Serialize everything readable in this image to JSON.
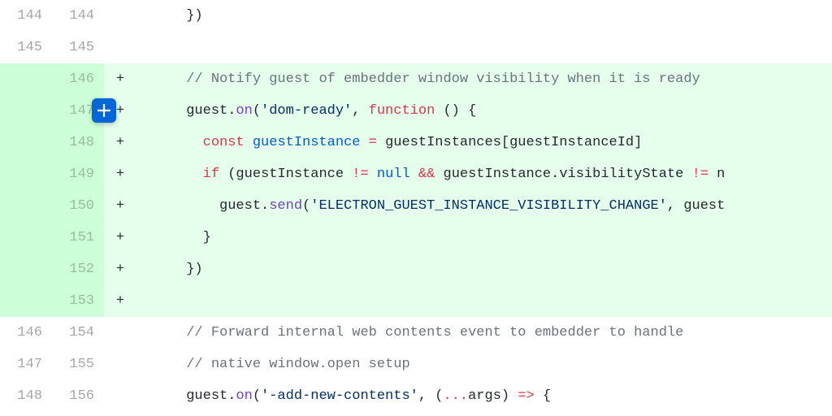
{
  "rows": [
    {
      "old": "144",
      "new": "144",
      "marker": "",
      "type": "context",
      "tokens": [
        {
          "t": "      })",
          "c": ""
        }
      ]
    },
    {
      "old": "145",
      "new": "145",
      "marker": "",
      "type": "context",
      "tokens": [
        {
          "t": "",
          "c": ""
        }
      ]
    },
    {
      "old": "",
      "new": "146",
      "marker": "+",
      "type": "added",
      "tokens": [
        {
          "t": "      ",
          "c": ""
        },
        {
          "t": "// Notify guest of embedder window visibility when it is ready",
          "c": "c-comment"
        }
      ]
    },
    {
      "old": "",
      "new": "147",
      "marker": "+",
      "type": "added",
      "addbtn": true,
      "tokens": [
        {
          "t": "      guest.",
          "c": ""
        },
        {
          "t": "on",
          "c": "c-func"
        },
        {
          "t": "(",
          "c": ""
        },
        {
          "t": "'dom-ready'",
          "c": "c-str"
        },
        {
          "t": ", ",
          "c": ""
        },
        {
          "t": "function",
          "c": "c-kw"
        },
        {
          "t": " () {",
          "c": ""
        }
      ]
    },
    {
      "old": "",
      "new": "148",
      "marker": "+",
      "type": "added",
      "tokens": [
        {
          "t": "        ",
          "c": ""
        },
        {
          "t": "const",
          "c": "c-kw"
        },
        {
          "t": " ",
          "c": ""
        },
        {
          "t": "guestInstance",
          "c": "c-const"
        },
        {
          "t": " ",
          "c": ""
        },
        {
          "t": "=",
          "c": "c-kw"
        },
        {
          "t": " guestInstances[guestInstanceId]",
          "c": ""
        }
      ]
    },
    {
      "old": "",
      "new": "149",
      "marker": "+",
      "type": "added",
      "tokens": [
        {
          "t": "        ",
          "c": ""
        },
        {
          "t": "if",
          "c": "c-kw"
        },
        {
          "t": " (guestInstance ",
          "c": ""
        },
        {
          "t": "!=",
          "c": "c-kw"
        },
        {
          "t": " ",
          "c": ""
        },
        {
          "t": "null",
          "c": "c-const"
        },
        {
          "t": " ",
          "c": ""
        },
        {
          "t": "&&",
          "c": "c-kw"
        },
        {
          "t": " guestInstance.visibilityState ",
          "c": ""
        },
        {
          "t": "!=",
          "c": "c-kw"
        },
        {
          "t": " n",
          "c": ""
        }
      ]
    },
    {
      "old": "",
      "new": "150",
      "marker": "+",
      "type": "added",
      "tokens": [
        {
          "t": "          guest.",
          "c": ""
        },
        {
          "t": "send",
          "c": "c-func"
        },
        {
          "t": "(",
          "c": ""
        },
        {
          "t": "'ELECTRON_GUEST_INSTANCE_VISIBILITY_CHANGE'",
          "c": "c-str"
        },
        {
          "t": ", guest",
          "c": ""
        }
      ]
    },
    {
      "old": "",
      "new": "151",
      "marker": "+",
      "type": "added",
      "tokens": [
        {
          "t": "        }",
          "c": ""
        }
      ]
    },
    {
      "old": "",
      "new": "152",
      "marker": "+",
      "type": "added",
      "tokens": [
        {
          "t": "      })",
          "c": ""
        }
      ]
    },
    {
      "old": "",
      "new": "153",
      "marker": "+",
      "type": "added",
      "tokens": [
        {
          "t": "",
          "c": ""
        }
      ]
    },
    {
      "old": "146",
      "new": "154",
      "marker": "",
      "type": "context",
      "tokens": [
        {
          "t": "      ",
          "c": ""
        },
        {
          "t": "// Forward internal web contents event to embedder to handle",
          "c": "c-comment"
        }
      ]
    },
    {
      "old": "147",
      "new": "155",
      "marker": "",
      "type": "context",
      "tokens": [
        {
          "t": "      ",
          "c": ""
        },
        {
          "t": "// native window.open setup",
          "c": "c-comment"
        }
      ]
    },
    {
      "old": "148",
      "new": "156",
      "marker": "",
      "type": "context",
      "tokens": [
        {
          "t": "      guest.",
          "c": ""
        },
        {
          "t": "on",
          "c": "c-func"
        },
        {
          "t": "(",
          "c": ""
        },
        {
          "t": "'-add-new-contents'",
          "c": "c-str"
        },
        {
          "t": ", (",
          "c": ""
        },
        {
          "t": "...",
          "c": "c-kw"
        },
        {
          "t": "args",
          "c": ""
        },
        {
          "t": ") ",
          "c": ""
        },
        {
          "t": "=>",
          "c": "c-kw"
        },
        {
          "t": " {",
          "c": ""
        }
      ]
    }
  ]
}
